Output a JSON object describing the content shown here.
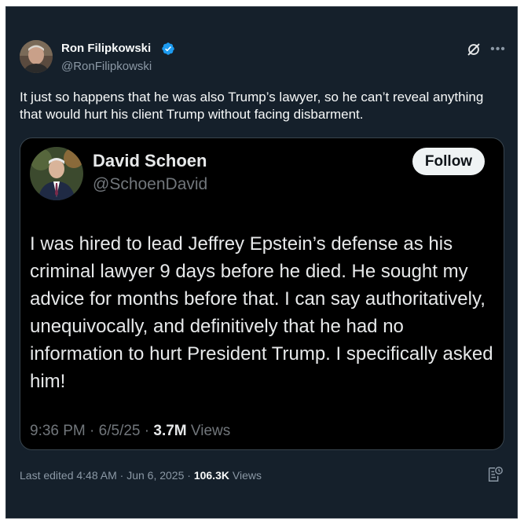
{
  "author": {
    "name": "Ron Filipkowski",
    "handle": "@RonFilipkowski",
    "verified": true
  },
  "tweet": {
    "text": "It just so happens that he was also Trump’s lawyer, so he can’t reveal anything that would hurt his client Trump without facing disbarment."
  },
  "quoted": {
    "name": "David Schoen",
    "handle": "@SchoenDavid",
    "follow_label": "Follow",
    "text": "I was hired to lead Jeffrey Epstein’s defense as his criminal lawyer 9 days before he died.  He sought my advice for months before that.  I can say authoritatively, unequivocally, and definitively that he had no information to hurt President Trump.  I specifically asked him!",
    "time": "9:36 PM",
    "date": "6/5/25",
    "views_count": "3.7M",
    "views_label": "Views",
    "separator": "·"
  },
  "footer": {
    "edited_label": "Last edited 4:48 AM · Jun 6, 2025",
    "separator": "·",
    "views_count": "106.3K",
    "views_label": "Views"
  },
  "icons": {
    "verified": "verified-badge-icon",
    "grok": "grok-icon",
    "more": "more-options-icon",
    "edit_history": "edit-history-icon"
  },
  "colors": {
    "background": "#15202b",
    "quote_background": "#000000",
    "verified_blue": "#1d9bf0",
    "text_primary": "#f7f9f9",
    "text_secondary": "#8b98a5"
  }
}
